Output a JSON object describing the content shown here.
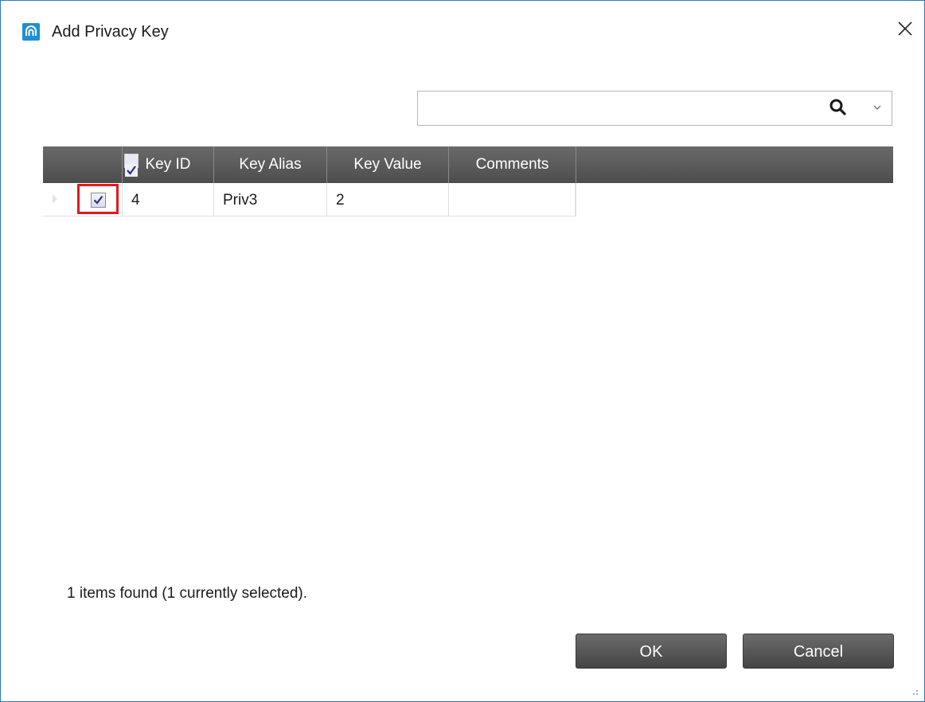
{
  "dialog": {
    "title": "Add Privacy Key",
    "icon": "app-logo-icon",
    "close_icon": "close-icon"
  },
  "search": {
    "value": "",
    "placeholder": "",
    "search_icon": "search-icon",
    "dropdown_icon": "chevron-down-icon"
  },
  "grid": {
    "columns": [
      "Key ID",
      "Key Alias",
      "Key Value",
      "Comments"
    ],
    "header_checkbox": "checked",
    "rows": [
      {
        "checked": true,
        "key_id": "4",
        "key_alias": "Priv3",
        "key_value": "2",
        "comments": ""
      }
    ]
  },
  "status": {
    "text": "1 items found (1 currently selected)."
  },
  "buttons": {
    "ok": "OK",
    "cancel": "Cancel"
  },
  "colors": {
    "accent": "#1e8fd6",
    "header_bg": "#555555",
    "highlight": "#e0191e"
  }
}
